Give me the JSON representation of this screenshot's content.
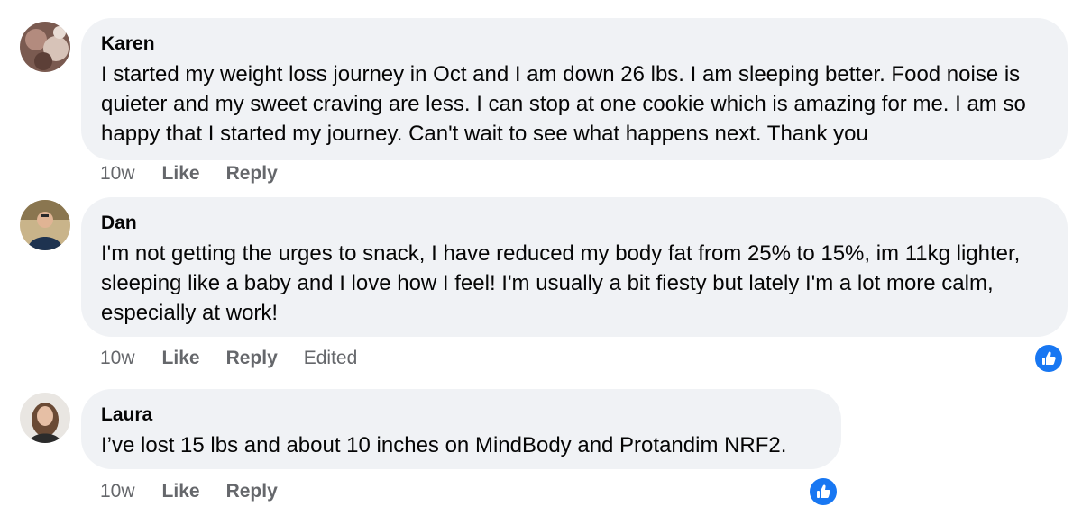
{
  "comments": [
    {
      "author": "Karen",
      "text": "I started my weight loss journey in Oct and I am down 26 lbs. I am sleeping better. Food noise is quieter and my sweet craving are less. I can stop at one cookie which is amazing for me. I am so happy that I started my journey. Can't wait to see what happens next. Thank you",
      "time": "10w",
      "like_label": "Like",
      "reply_label": "Reply",
      "avatar_icon": "user-avatar-photo"
    },
    {
      "author": "Dan",
      "text": "I'm not getting the urges to snack, I have reduced my body fat from 25% to 15%, im 11kg lighter, sleeping like a baby and I love how I feel! I'm usually a bit fiesty but lately I'm a lot more calm, especially at work!",
      "time": "10w",
      "like_label": "Like",
      "reply_label": "Reply",
      "edited_label": "Edited",
      "reaction_icon": "thumbs-up-icon",
      "avatar_icon": "user-avatar-photo"
    },
    {
      "author": "Laura",
      "text": "I’ve lost 15 lbs and about 10 inches on MindBody and Protandim NRF2.",
      "time": "10w",
      "like_label": "Like",
      "reply_label": "Reply",
      "reaction_icon": "thumbs-up-icon",
      "avatar_icon": "user-avatar-photo"
    }
  ],
  "colors": {
    "bubble": "#f0f2f5",
    "meta_text": "#65676b",
    "like_badge": "#1877f2"
  }
}
